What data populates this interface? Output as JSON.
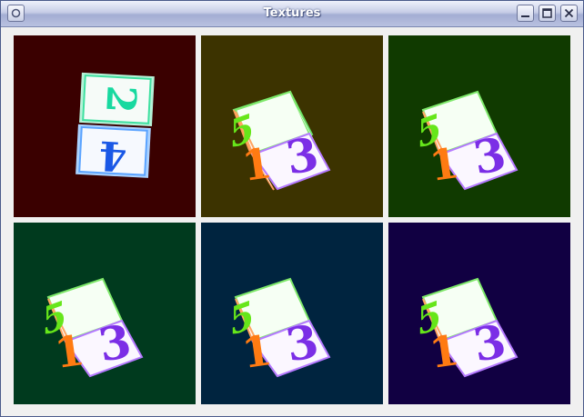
{
  "window": {
    "title": "Textures"
  },
  "colors": {
    "tile_backgrounds": [
      "#3a0000",
      "#3c3300",
      "#103a00",
      "#003a1e",
      "#00243f",
      "#110042"
    ]
  },
  "icons": {
    "window_menu": "circle-icon",
    "minimize": "minimize-icon",
    "maximize": "maximize-icon",
    "close": "close-icon"
  },
  "cube_faces": {
    "top": "5",
    "left": "1",
    "right": "3",
    "first_tile_top": "2",
    "first_tile_bottom": "4"
  }
}
